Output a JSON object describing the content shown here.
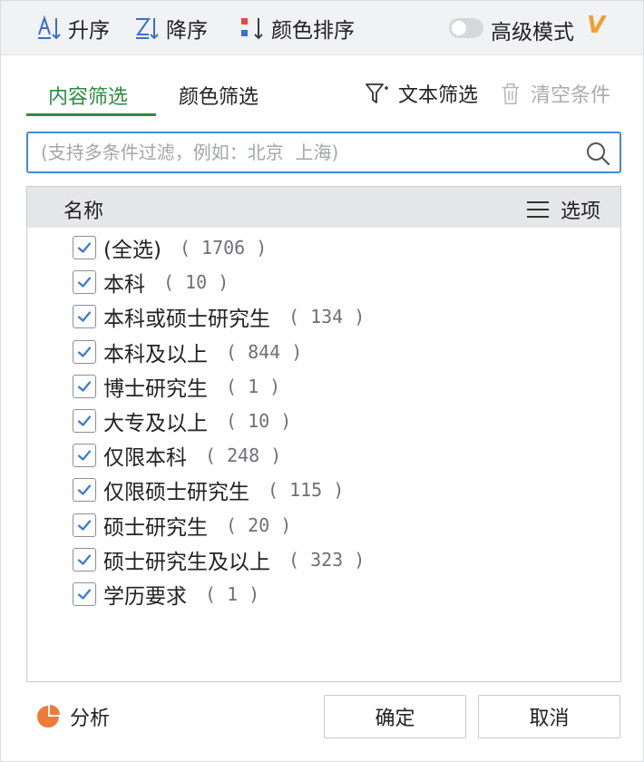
{
  "toolbar": {
    "sort_asc": "升序",
    "sort_desc": "降序",
    "color_sort": "颜色排序",
    "advanced_mode": "高级模式",
    "vip_badge": "V"
  },
  "tabs": {
    "content_filter": "内容筛选",
    "color_filter": "颜色筛选"
  },
  "actions": {
    "text_filter": "文本筛选",
    "clear_conditions": "清空条件"
  },
  "search": {
    "placeholder": "(支持多条件过滤，例如：北京  上海)",
    "value": ""
  },
  "list": {
    "header_name": "名称",
    "header_options": "选项",
    "items": [
      {
        "label": "(全选)",
        "count": "1706",
        "checked": true
      },
      {
        "label": "本科",
        "count": "10",
        "checked": true
      },
      {
        "label": "本科或硕士研究生",
        "count": "134",
        "checked": true
      },
      {
        "label": "本科及以上",
        "count": "844",
        "checked": true
      },
      {
        "label": "博士研究生",
        "count": "1",
        "checked": true
      },
      {
        "label": "大专及以上",
        "count": "10",
        "checked": true
      },
      {
        "label": "仅限本科",
        "count": "248",
        "checked": true
      },
      {
        "label": "仅限硕士研究生",
        "count": "115",
        "checked": true
      },
      {
        "label": "硕士研究生",
        "count": "20",
        "checked": true
      },
      {
        "label": "硕士研究生及以上",
        "count": "323",
        "checked": true
      },
      {
        "label": "学历要求",
        "count": "1",
        "checked": true
      }
    ]
  },
  "footer": {
    "analyze": "分析",
    "ok": "确定",
    "cancel": "取消"
  },
  "colors": {
    "accent_green": "#2e8b3f",
    "focus_blue": "#4a86d9",
    "checkbox_blue": "#3a78d6",
    "vip_orange": "#f0a030",
    "pie_orange": "#f07a3a"
  }
}
